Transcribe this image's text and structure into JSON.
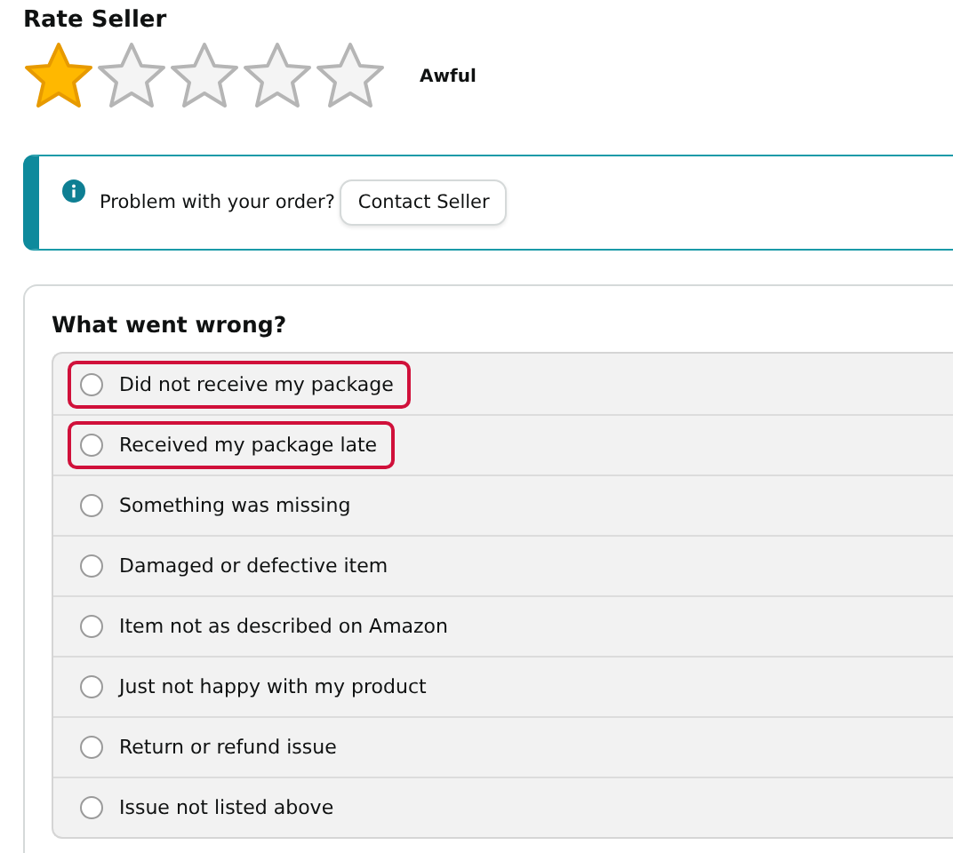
{
  "rating": {
    "title": "Rate Seller",
    "stars": 1,
    "label": "Awful"
  },
  "notice": {
    "text": "Problem with your order?",
    "button": "Contact Seller"
  },
  "question": {
    "title": "What went wrong?",
    "options": [
      {
        "label": "Did not receive my package",
        "selected": false,
        "highlighted": true
      },
      {
        "label": "Received my package late",
        "selected": false,
        "highlighted": true
      },
      {
        "label": "Something was missing",
        "selected": false,
        "highlighted": false
      },
      {
        "label": "Damaged or defective item",
        "selected": false,
        "highlighted": false
      },
      {
        "label": "Item not as described on Amazon",
        "selected": false,
        "highlighted": false
      },
      {
        "label": "Just not happy with my product",
        "selected": false,
        "highlighted": false
      },
      {
        "label": "Return or refund issue",
        "selected": false,
        "highlighted": false
      },
      {
        "label": "Issue not listed above",
        "selected": false,
        "highlighted": false
      }
    ]
  }
}
